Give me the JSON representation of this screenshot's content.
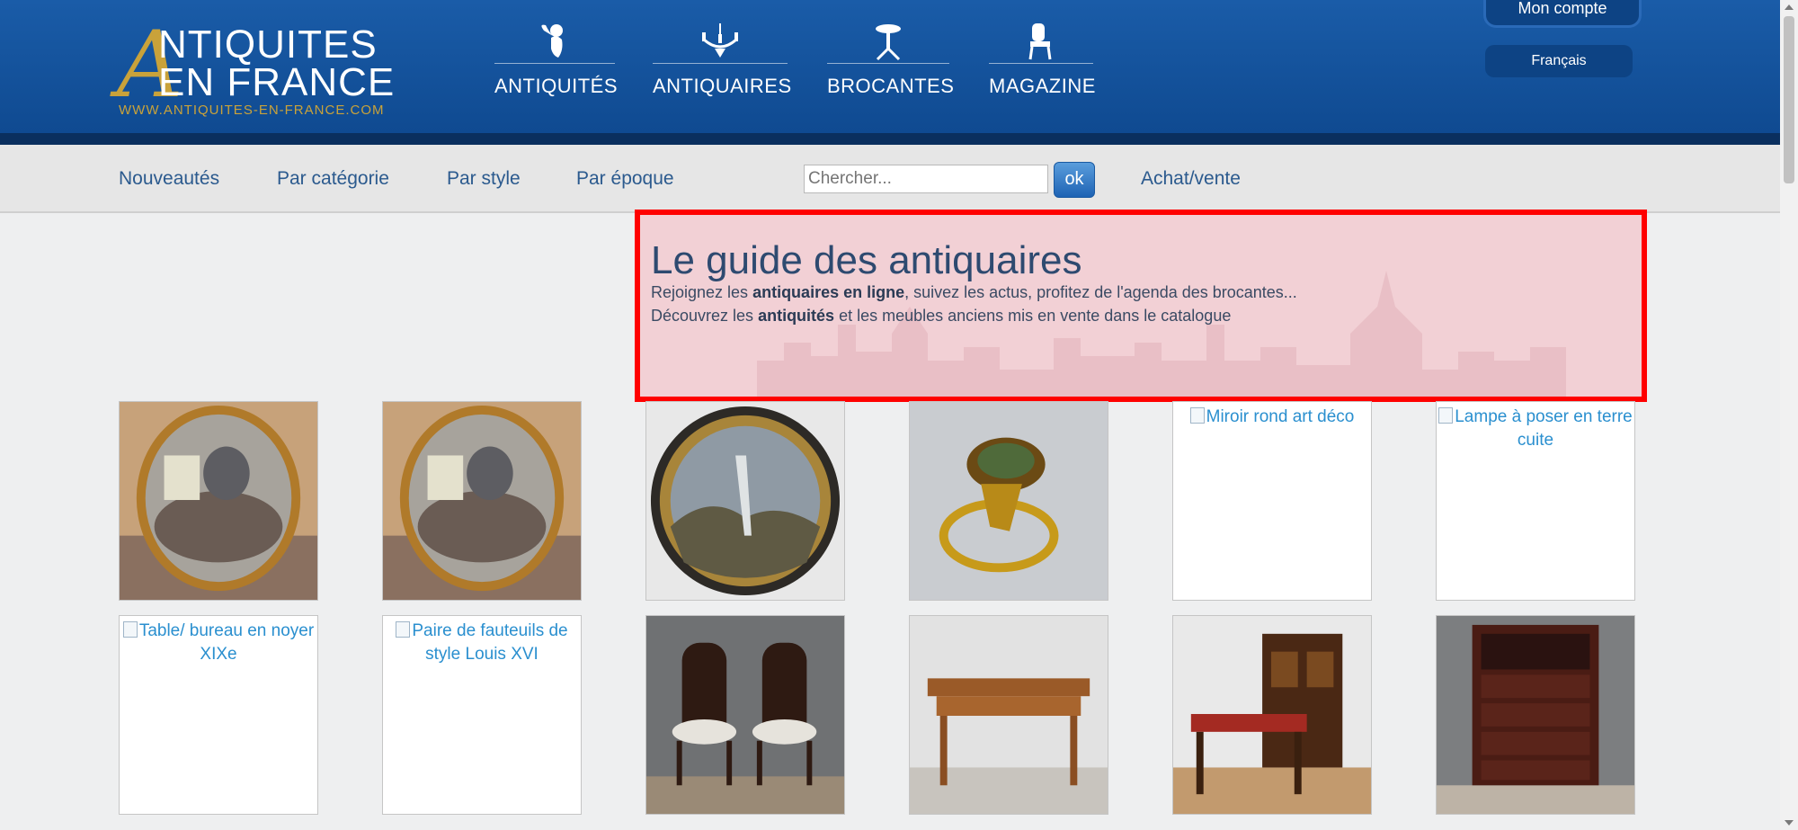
{
  "header": {
    "logo": {
      "big_letter": "A",
      "line1": "NTIQUITES",
      "line2": "EN FRANCE",
      "url": "WWW.ANTIQUITES-EN-FRANCE.COM"
    },
    "nav": [
      {
        "label": "ANTIQUITÉS",
        "icon": "cherub-icon"
      },
      {
        "label": "ANTIQUAIRES",
        "icon": "chandelier-icon"
      },
      {
        "label": "BROCANTES",
        "icon": "table-icon"
      },
      {
        "label": "MAGAZINE",
        "icon": "chair-icon"
      }
    ],
    "account_label": "Mon compte",
    "language": "Français"
  },
  "subnav": {
    "links": [
      "Nouveautés",
      "Par catégorie",
      "Par style",
      "Par époque"
    ],
    "search_placeholder": "Chercher...",
    "search_button": "ok",
    "buy_sell": "Achat/vente"
  },
  "guide": {
    "title": "Le guide des antiquaires",
    "line1_pre": "Rejoignez les ",
    "line1_bold": "antiquaires en ligne",
    "line1_post": ", suivez les actus, profitez de l'agenda des brocantes...",
    "line2_pre": "Découvrez les ",
    "line2_bold": "antiquités",
    "line2_post": " et les meubles anciens mis en vente dans le catalogue"
  },
  "products": [
    {
      "type": "image",
      "subject": "oval-mirror"
    },
    {
      "type": "image",
      "subject": "oval-mirror"
    },
    {
      "type": "image",
      "subject": "round-painting"
    },
    {
      "type": "image",
      "subject": "gold-ring"
    },
    {
      "type": "broken",
      "alt": "Miroir rond art déco"
    },
    {
      "type": "broken",
      "alt": "Lampe à poser en terre cuite"
    },
    {
      "type": "broken",
      "alt": "Table/ bureau en noyer XIXe"
    },
    {
      "type": "broken",
      "alt": "Paire de fauteuils de style Louis XVI"
    },
    {
      "type": "image",
      "subject": "pair-of-chairs"
    },
    {
      "type": "image",
      "subject": "wooden-table"
    },
    {
      "type": "image",
      "subject": "desk-and-cabinet"
    },
    {
      "type": "image",
      "subject": "lacquered-cabinet"
    }
  ],
  "colors": {
    "header_blue": "#1a5ca8",
    "link_blue": "#2b5a8e",
    "alt_text_blue": "#2a8fcf",
    "highlight_border": "#ff0000",
    "highlight_fill": "#f2d0d5",
    "logo_gold": "#c9a23a"
  }
}
